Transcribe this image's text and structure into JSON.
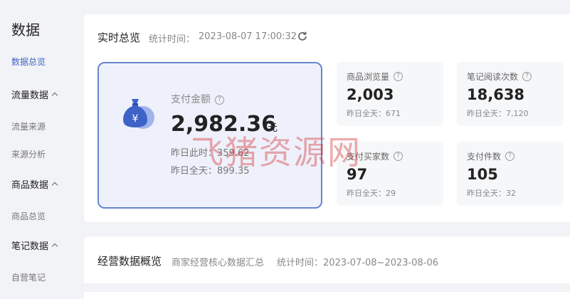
{
  "sidebar": {
    "title": "数据",
    "overview": "数据总览",
    "traffic_group": "流量数据",
    "traffic_items": [
      "流量来源",
      "来源分析"
    ],
    "goods_group": "商品数据",
    "goods_items": [
      "商品总览"
    ],
    "notes_group": "笔记数据",
    "notes_items": [
      "自营笔记"
    ]
  },
  "realtime": {
    "title": "实时总览",
    "time_label": "统计时间：",
    "time": "2023-08-07 17:00:32",
    "payment": {
      "label": "支付金额",
      "value": "2,982.36",
      "unit": "元",
      "yesterday_same_time": "昨日此时：359.62",
      "yesterday_full": "昨日全天：899.35"
    },
    "stats": [
      {
        "label": "商品浏览量",
        "value": "2,003",
        "sub": "昨日全天：671"
      },
      {
        "label": "笔记阅读次数",
        "value": "18,638",
        "sub": "昨日全天：7,120"
      },
      {
        "label": "支付买家数",
        "value": "97",
        "sub": "昨日全天：29"
      },
      {
        "label": "支付件数",
        "value": "105",
        "sub": "昨日全天：32"
      }
    ]
  },
  "overview": {
    "title": "经营数据概览",
    "desc": "商家经营核心数据汇总",
    "time": "统计时间：2023-07-08~2023-08-06"
  },
  "watermark": "飞猪资源网",
  "colors": {
    "accent": "#3d63c8",
    "card_border": "#6686cf",
    "card_bg": "#eef1fb"
  }
}
